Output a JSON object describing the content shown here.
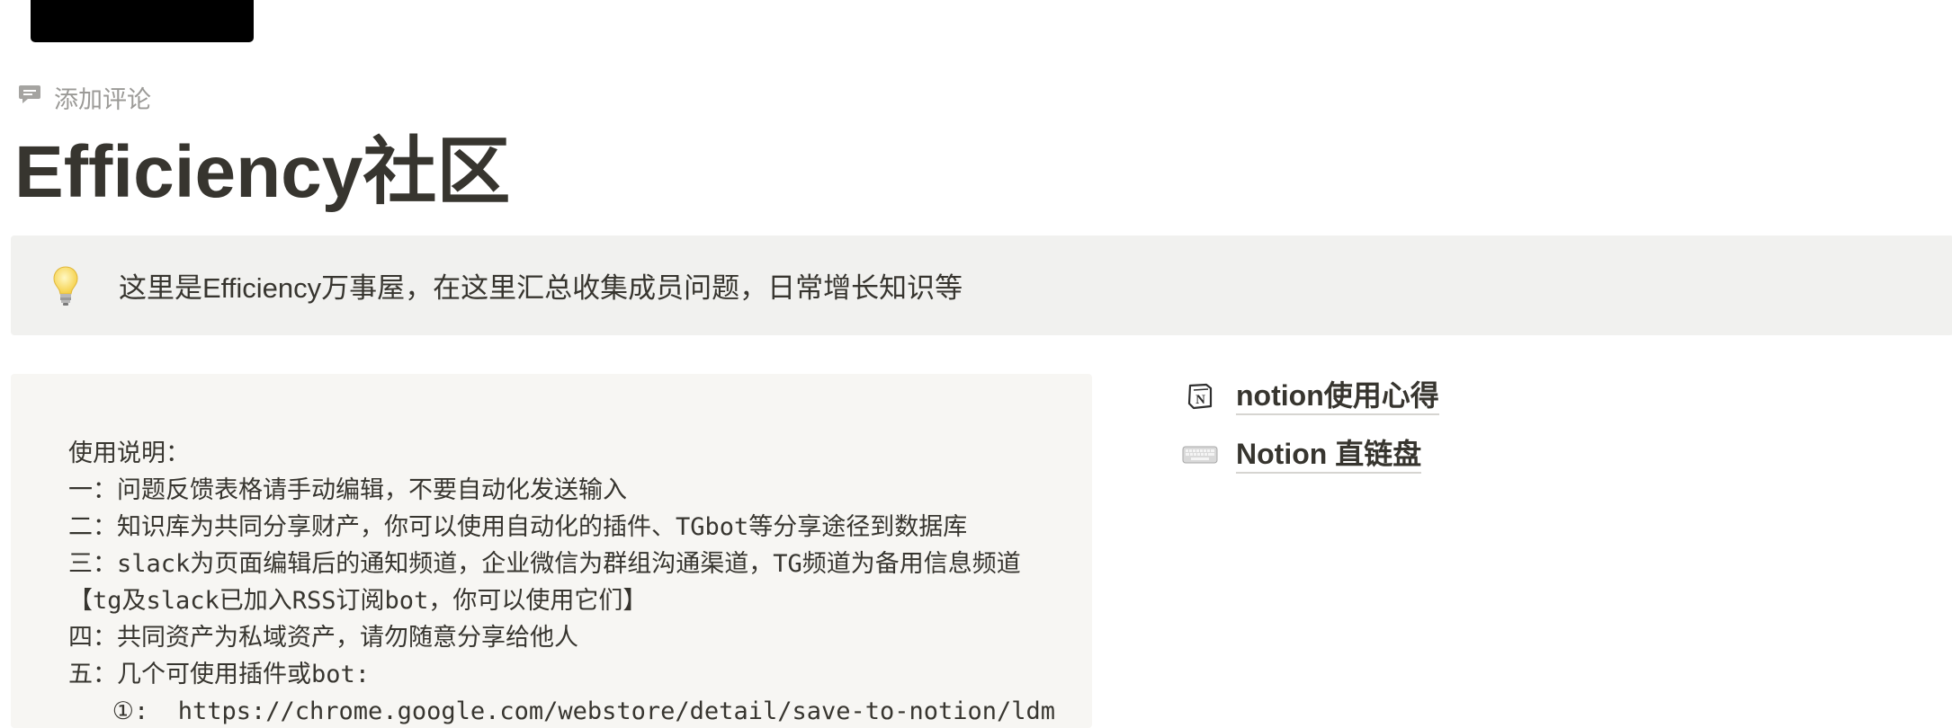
{
  "header": {
    "add_comment_label": "添加评论",
    "add_comment_icon": "comment-icon"
  },
  "page": {
    "title": "Efficiency社区"
  },
  "callout": {
    "icon": "lightbulb-icon",
    "text": "这里是Efficiency万事屋，在这里汇总收集成员问题，日常增长知识等"
  },
  "code_block": {
    "lines": [
      "使用说明：",
      "一：问题反馈表格请手动编辑，不要自动化发送输入",
      "二：知识库为共同分享财产，你可以使用自动化的插件、TGbot等分享途径到数据库",
      "三：slack为页面编辑后的通知频道，企业微信为群组沟通渠道，TG频道为备用信息频道",
      "【tg及slack已加入RSS订阅bot，你可以使用它们】",
      "四：共同资产为私域资产，请勿随意分享给他人",
      "五：几个可使用插件或bot:",
      "   ①:  https://chrome.google.com/webstore/detail/save-to-notion/ldm"
    ]
  },
  "links": [
    {
      "label": "notion使用心得",
      "icon": "notion-logo-icon"
    },
    {
      "label": "Notion 直链盘",
      "icon": "keyboard-icon"
    }
  ],
  "colors": {
    "text": "#37352f",
    "muted": "#9b9a97",
    "callout_bg": "#f1f1ef",
    "code_bg": "#f7f6f3"
  }
}
